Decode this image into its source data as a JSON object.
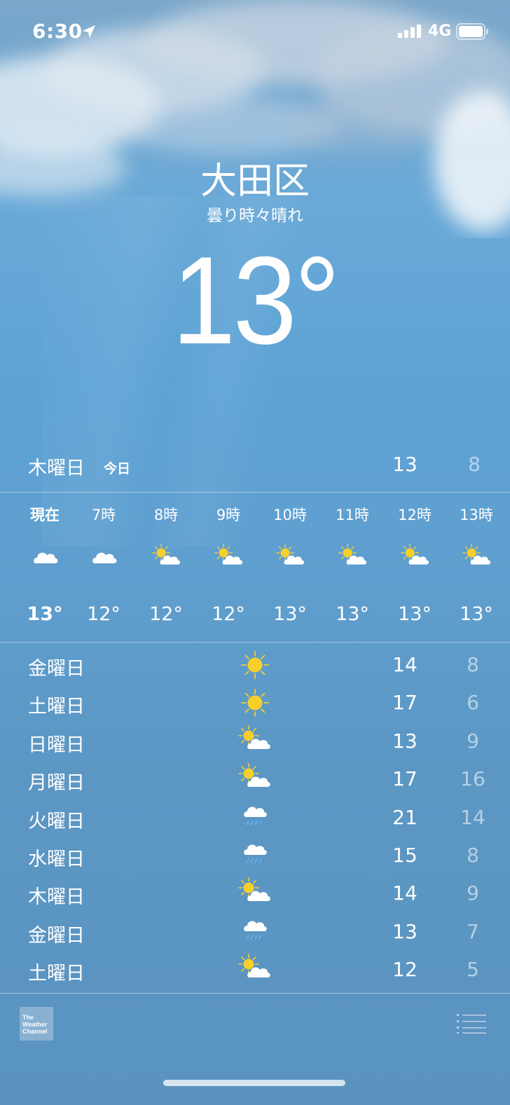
{
  "status_bar": {
    "time": "6:30",
    "network": "4G"
  },
  "header": {
    "city": "大田区",
    "condition": "曇り時々晴れ",
    "temperature": "13°"
  },
  "today": {
    "day": "木曜日",
    "tag": "今日",
    "high": "13",
    "low": "8"
  },
  "hourly": [
    {
      "label": "現在",
      "icon": "cloud-icon",
      "temp": "13°"
    },
    {
      "label": "7時",
      "icon": "cloud-icon",
      "temp": "12°"
    },
    {
      "label": "8時",
      "icon": "partly-sunny-icon",
      "temp": "12°"
    },
    {
      "label": "9時",
      "icon": "partly-sunny-icon",
      "temp": "12°"
    },
    {
      "label": "10時",
      "icon": "partly-sunny-icon",
      "temp": "13°"
    },
    {
      "label": "11時",
      "icon": "partly-sunny-icon",
      "temp": "13°"
    },
    {
      "label": "12時",
      "icon": "partly-sunny-icon",
      "temp": "13°"
    },
    {
      "label": "13時",
      "icon": "partly-sunny-icon",
      "temp": "13°"
    }
  ],
  "daily": [
    {
      "day": "金曜日",
      "icon": "sun-icon",
      "high": "14",
      "low": "8"
    },
    {
      "day": "土曜日",
      "icon": "sun-icon",
      "high": "17",
      "low": "6"
    },
    {
      "day": "日曜日",
      "icon": "partly-sunny-icon",
      "high": "13",
      "low": "9"
    },
    {
      "day": "月曜日",
      "icon": "partly-sunny-icon",
      "high": "17",
      "low": "16"
    },
    {
      "day": "火曜日",
      "icon": "rain-icon",
      "high": "21",
      "low": "14"
    },
    {
      "day": "水曜日",
      "icon": "rain-icon",
      "high": "15",
      "low": "8"
    },
    {
      "day": "木曜日",
      "icon": "partly-sunny-icon",
      "high": "14",
      "low": "9"
    },
    {
      "day": "金曜日",
      "icon": "rain-icon",
      "high": "13",
      "low": "7"
    },
    {
      "day": "土曜日",
      "icon": "partly-sunny-icon",
      "high": "12",
      "low": "5"
    }
  ],
  "footer": {
    "logo_text": "The Weather Channel"
  },
  "colors": {
    "sky_top": "#7aa6c9",
    "sky_mid": "#5da3d6",
    "sky_bottom": "#5a93bf",
    "sun": "#f7cf2b",
    "rain": "#5fb3ef"
  }
}
